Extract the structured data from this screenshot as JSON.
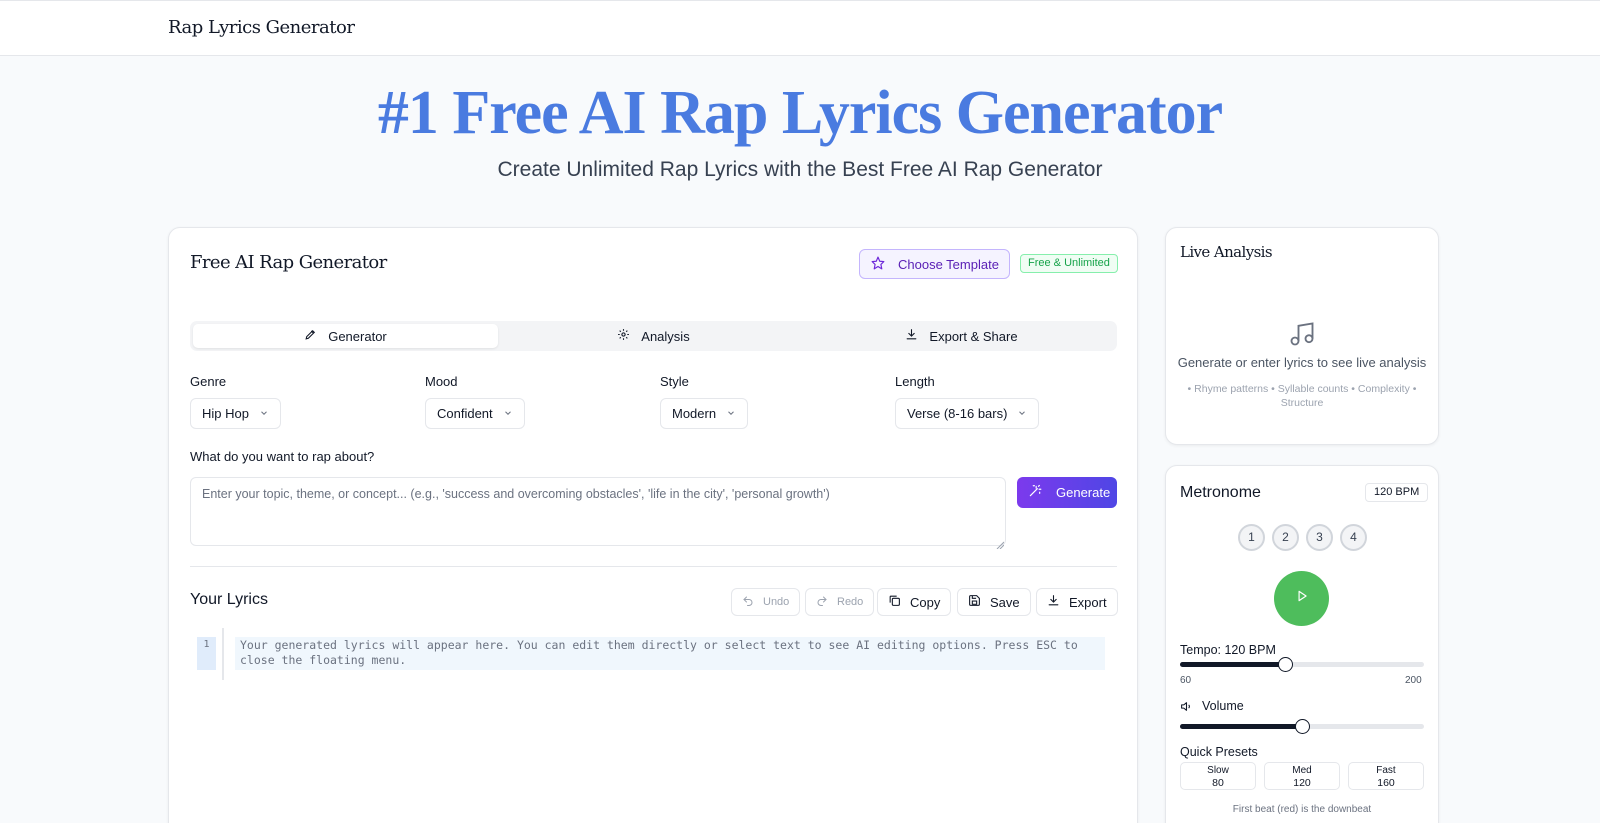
{
  "header": {
    "brand": "Rap Lyrics Generator"
  },
  "hero": {
    "title": "#1 Free AI Rap Lyrics Generator",
    "subtitle": "Create Unlimited Rap Lyrics with the Best Free AI Rap Generator"
  },
  "generator": {
    "title": "Free AI Rap Generator",
    "template_button": "Choose Template",
    "badge": "Free & Unlimited",
    "tabs": [
      {
        "label": "Generator",
        "icon": "pen-icon",
        "active": true
      },
      {
        "label": "Analysis",
        "icon": "gear-icon",
        "active": false
      },
      {
        "label": "Export & Share",
        "icon": "download-icon",
        "active": false
      }
    ],
    "fields": {
      "genre": {
        "label": "Genre",
        "value": "Hip Hop"
      },
      "mood": {
        "label": "Mood",
        "value": "Confident"
      },
      "style": {
        "label": "Style",
        "value": "Modern"
      },
      "length": {
        "label": "Length",
        "value": "Verse (8-16 bars)"
      }
    },
    "topic": {
      "label": "What do you want to rap about?",
      "placeholder": "Enter your topic, theme, or concept... (e.g., 'success and overcoming obstacles', 'life in the city', 'personal growth')"
    },
    "generate_button": "Generate"
  },
  "lyrics": {
    "title": "Your Lyrics",
    "toolbar": {
      "undo": "Undo",
      "redo": "Redo",
      "copy": "Copy",
      "save": "Save",
      "export": "Export"
    },
    "line_number": "1",
    "placeholder": "Your generated lyrics will appear here. You can edit them directly or select text to see AI editing options. Press ESC to close the floating menu."
  },
  "analysis": {
    "title": "Live Analysis",
    "message": "Generate or enter lyrics to see live analysis",
    "hint": "• Rhyme patterns • Syllable counts • Complexity • Structure"
  },
  "metronome": {
    "title": "Metronome",
    "bpm_badge": "120 BPM",
    "beats": [
      "1",
      "2",
      "3",
      "4"
    ],
    "tempo_label": "Tempo: 120 BPM",
    "tempo": {
      "min": "60",
      "max": "200",
      "value": 120
    },
    "volume_label": "Volume",
    "volume_level": 0.5,
    "presets_label": "Quick Presets",
    "presets": [
      {
        "name": "Slow",
        "bpm": "80"
      },
      {
        "name": "Med",
        "bpm": "120"
      },
      {
        "name": "Fast",
        "bpm": "160"
      }
    ],
    "footer": "First beat (red) is the downbeat"
  }
}
